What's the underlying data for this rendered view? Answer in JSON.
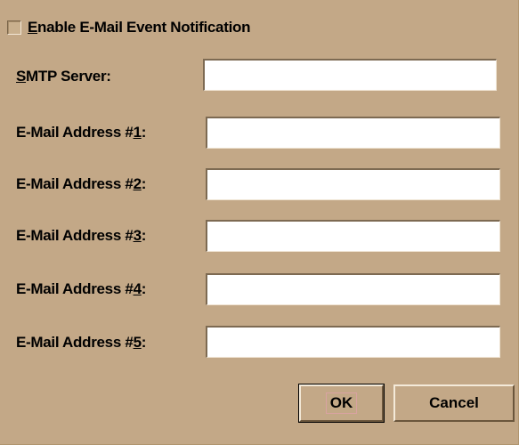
{
  "dialog": {
    "enable_checkbox": {
      "label_mnemonic": "E",
      "label_rest": "nable E-Mail Event Notification",
      "checked": false
    },
    "fields": [
      {
        "label_pre": "",
        "label_mnemonic": "S",
        "label_post": "MTP Server:",
        "value": ""
      },
      {
        "label_pre": "E-Mail Address #",
        "label_mnemonic": "1",
        "label_post": ":",
        "value": ""
      },
      {
        "label_pre": "E-Mail Address #",
        "label_mnemonic": "2",
        "label_post": ":",
        "value": ""
      },
      {
        "label_pre": "E-Mail Address #",
        "label_mnemonic": "3",
        "label_post": ":",
        "value": ""
      },
      {
        "label_pre": "E-Mail Address #",
        "label_mnemonic": "4",
        "label_post": ":",
        "value": ""
      },
      {
        "label_pre": "E-Mail Address #",
        "label_mnemonic": "5",
        "label_post": ":",
        "value": ""
      }
    ],
    "buttons": {
      "ok_label": "OK",
      "cancel_label": "Cancel"
    }
  }
}
